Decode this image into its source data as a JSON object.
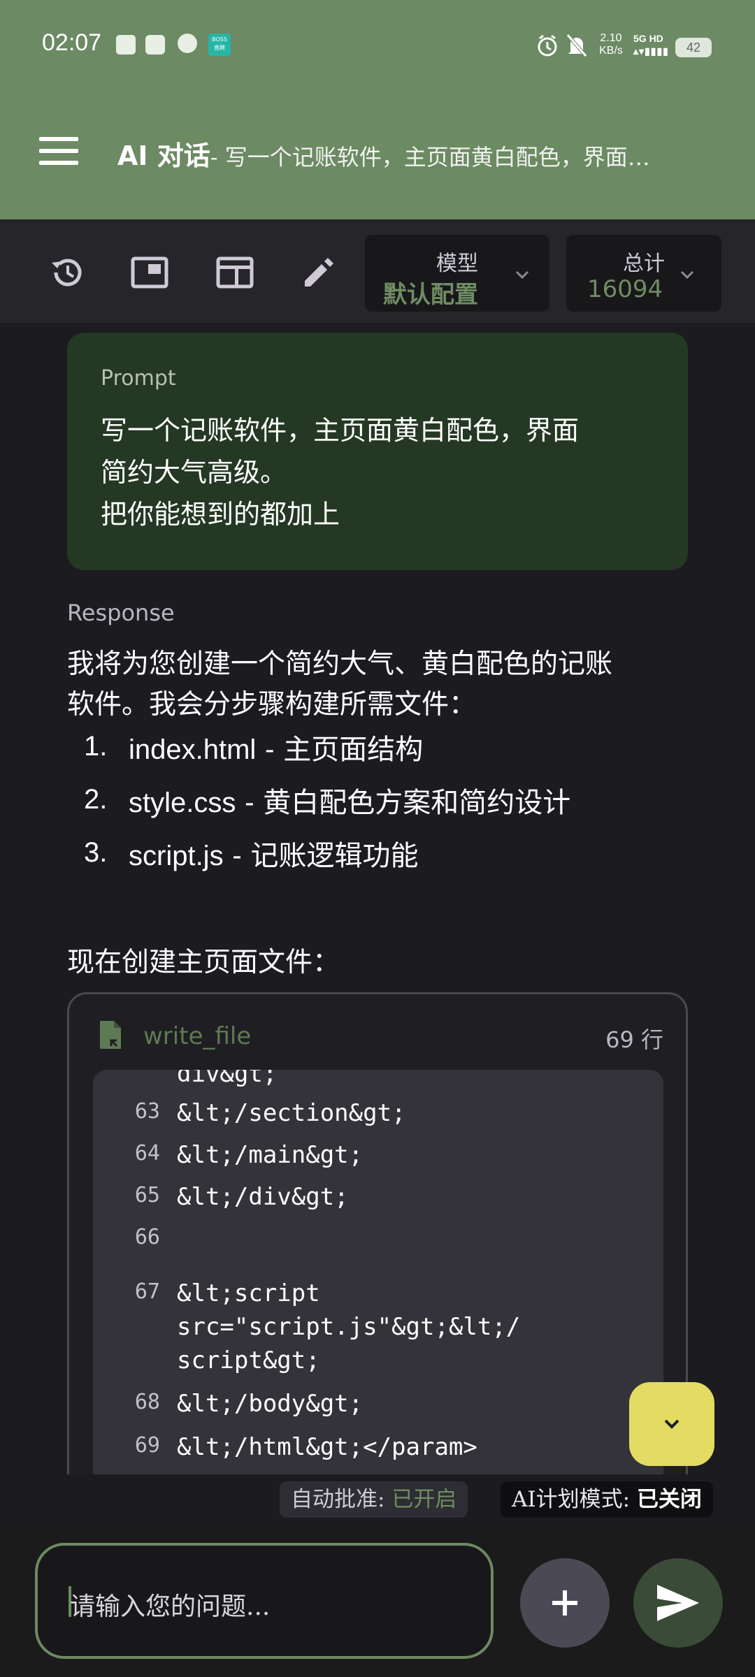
{
  "status_bar": {
    "time": "02:07",
    "net_speed": "2.10",
    "net_unit": "KB/s",
    "net_type": "5G HD",
    "battery": "42",
    "boss_label": "BOSS\n直聘"
  },
  "header": {
    "title": "AI 对话",
    "subtitle": "- 写一个记账软件，主页面黄白配色，界面…"
  },
  "toolbar": {
    "model_label": "模型",
    "model_value": "默认配置",
    "total_label": "总计",
    "total_value": "16094"
  },
  "prompt": {
    "label": "Prompt",
    "line1": "写一个记账软件，主页面黄白配色，界面",
    "line2": "简约大气高级。",
    "line3": "把你能想到的都加上"
  },
  "response": {
    "label": "Response",
    "intro_line1": "我将为您创建一个简约大气、黄白配色的记账",
    "intro_line2": "软件。我会分步骤构建所需文件：",
    "items": [
      {
        "num": "1.",
        "name": "index.html",
        "desc": " - 主页面结构"
      },
      {
        "num": "2.",
        "name": "style.css",
        "desc": " - 黄白配色方案和简约设计"
      },
      {
        "num": "3.",
        "name": "script.js",
        "desc": " - 记账逻辑功能"
      }
    ],
    "now_text": "现在创建主页面文件："
  },
  "file_card": {
    "name": "write_file",
    "line_count": "69 行",
    "code_partial": "div&gt;",
    "code_lines": [
      {
        "n": "63",
        "t": "&lt;/section&gt;"
      },
      {
        "n": "64",
        "t": "&lt;/main&gt;"
      },
      {
        "n": "65",
        "t": "&lt;/div&gt;"
      },
      {
        "n": "66",
        "t": ""
      },
      {
        "n": "67",
        "t": "&lt;script\nsrc=\"script.js\"&gt;&lt;/\nscript&gt;"
      },
      {
        "n": "68",
        "t": "&lt;/body&gt;"
      },
      {
        "n": "69",
        "t": "&lt;/html&gt;</param>"
      }
    ]
  },
  "chips": {
    "auto_label": "自动批准: ",
    "auto_value": "已开启",
    "plan_label": "AI计划模式: ",
    "plan_value": "已关闭"
  },
  "input": {
    "placeholder": "请输入您的问题..."
  },
  "colors": {
    "header": "#6c8a63",
    "accent_green": "#6f8c63",
    "prompt_bg": "#243823",
    "fab_yellow": "#e3db62"
  }
}
